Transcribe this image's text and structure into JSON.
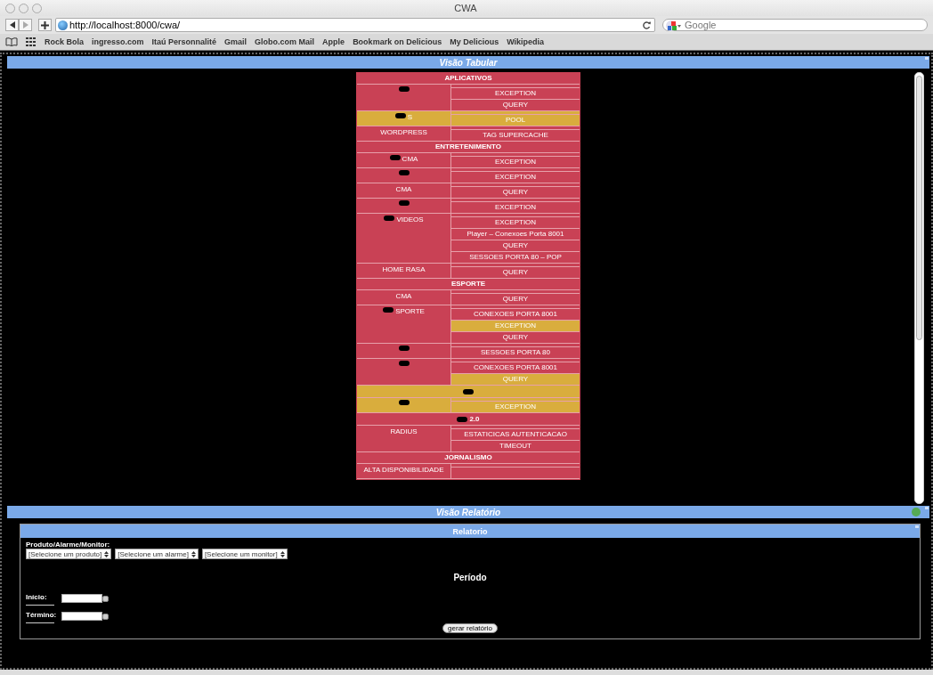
{
  "window": {
    "title": "CWA"
  },
  "toolbar": {
    "url": "http://localhost:8000/cwa/",
    "search_placeholder": "Google"
  },
  "bookmarks": [
    "Rock Bola",
    "ingresso.com",
    "Itaú Personnalité",
    "Gmail",
    "Globo.com Mail",
    "Apple",
    "Bookmark on Delicious",
    "My Delicious",
    "Wikipedia"
  ],
  "tabular_panel": {
    "title": "Visão Tabular",
    "sections": [
      {
        "title": "APLICATIVOS",
        "groups": [
          {
            "kind": "split",
            "redacted": true,
            "alert": false,
            "items": [
              {
                "label": "EXCEPTION",
                "alert": false
              },
              {
                "label": "QUERY",
                "alert": false
              }
            ]
          },
          {
            "kind": "split",
            "redacted": true,
            "name": "S",
            "alert": true,
            "items": [
              {
                "label": "POOL",
                "alert": true
              }
            ]
          },
          {
            "kind": "split",
            "redacted": false,
            "name": "WORDPRESS",
            "alert": false,
            "items": [
              {
                "label": "TAG SUPERCACHE",
                "alert": false
              }
            ]
          }
        ]
      },
      {
        "title": "ENTRETENIMENTO",
        "groups": [
          {
            "kind": "split",
            "redacted": true,
            "name": "CMA",
            "alert": false,
            "items": [
              {
                "label": "EXCEPTION",
                "alert": false
              }
            ]
          },
          {
            "kind": "split",
            "redacted": true,
            "alert": false,
            "items": [
              {
                "label": "EXCEPTION",
                "alert": false
              }
            ]
          },
          {
            "kind": "split",
            "redacted": false,
            "name": "CMA",
            "alert": false,
            "items": [
              {
                "label": "QUERY",
                "alert": false
              }
            ]
          },
          {
            "kind": "split",
            "redacted": true,
            "alert": false,
            "items": [
              {
                "label": "EXCEPTION",
                "alert": false
              }
            ]
          },
          {
            "kind": "split",
            "redacted": true,
            "name": "VIDEOS",
            "alert": false,
            "items": [
              {
                "label": "EXCEPTION",
                "alert": false
              },
              {
                "label": "Player – Conexoes Porta 8001",
                "alert": false
              },
              {
                "label": "QUERY",
                "alert": false
              },
              {
                "label": "SESSOES PORTA 80 – POP",
                "alert": false
              }
            ]
          },
          {
            "kind": "split",
            "redacted": false,
            "name": "HOME RASA",
            "alert": false,
            "items": [
              {
                "label": "QUERY",
                "alert": false
              }
            ]
          }
        ]
      },
      {
        "title": "ESPORTE",
        "groups": [
          {
            "kind": "split",
            "redacted": false,
            "name": "CMA",
            "alert": false,
            "items": [
              {
                "label": "QUERY",
                "alert": false
              }
            ]
          },
          {
            "kind": "split",
            "redacted": true,
            "name": "SPORTE",
            "alert": false,
            "items": [
              {
                "label": "CONEXOES PORTA 8001",
                "alert": false
              },
              {
                "label": "EXCEPTION",
                "alert": true
              },
              {
                "label": "QUERY",
                "alert": false
              }
            ]
          },
          {
            "kind": "split",
            "redacted": true,
            "alert": false,
            "items": [
              {
                "label": "SESSOES PORTA 80",
                "alert": false
              }
            ]
          },
          {
            "kind": "split",
            "redacted": true,
            "alert": false,
            "items": [
              {
                "label": "CONEXOES PORTA 8001",
                "alert": false
              },
              {
                "label": "QUERY",
                "alert": true
              }
            ]
          },
          {
            "kind": "span",
            "redacted": true,
            "alert": true
          },
          {
            "kind": "split",
            "redacted": true,
            "alert": true,
            "items": [
              {
                "label": "EXCEPTION",
                "alert": true
              }
            ]
          },
          {
            "kind": "span",
            "redacted": true,
            "name": "2.0",
            "alert": false
          },
          {
            "kind": "split",
            "redacted": false,
            "name": "RADIUS",
            "alert": false,
            "items": [
              {
                "label": "ESTATICICAS AUTENTICACAO",
                "alert": false
              },
              {
                "label": "TIMEOUT",
                "alert": false
              }
            ]
          }
        ]
      },
      {
        "title": "JORNALISMO",
        "groups": [
          {
            "kind": "split",
            "redacted": false,
            "name": "ALTA DISPONIBILIDADE",
            "alert": false
          }
        ]
      }
    ]
  },
  "report_panel": {
    "title": "Visão Relatório",
    "form": {
      "title": "Relatorio",
      "selector_label": "Produto/Alarme/Monitor:",
      "selects": [
        "[Selecione um produto]",
        "[Selecione um alarme]",
        "[Selecione um monitor]"
      ],
      "period_title": "Período",
      "start_label": "Início:",
      "end_label": "Término:",
      "submit": "gerar relatório"
    }
  }
}
